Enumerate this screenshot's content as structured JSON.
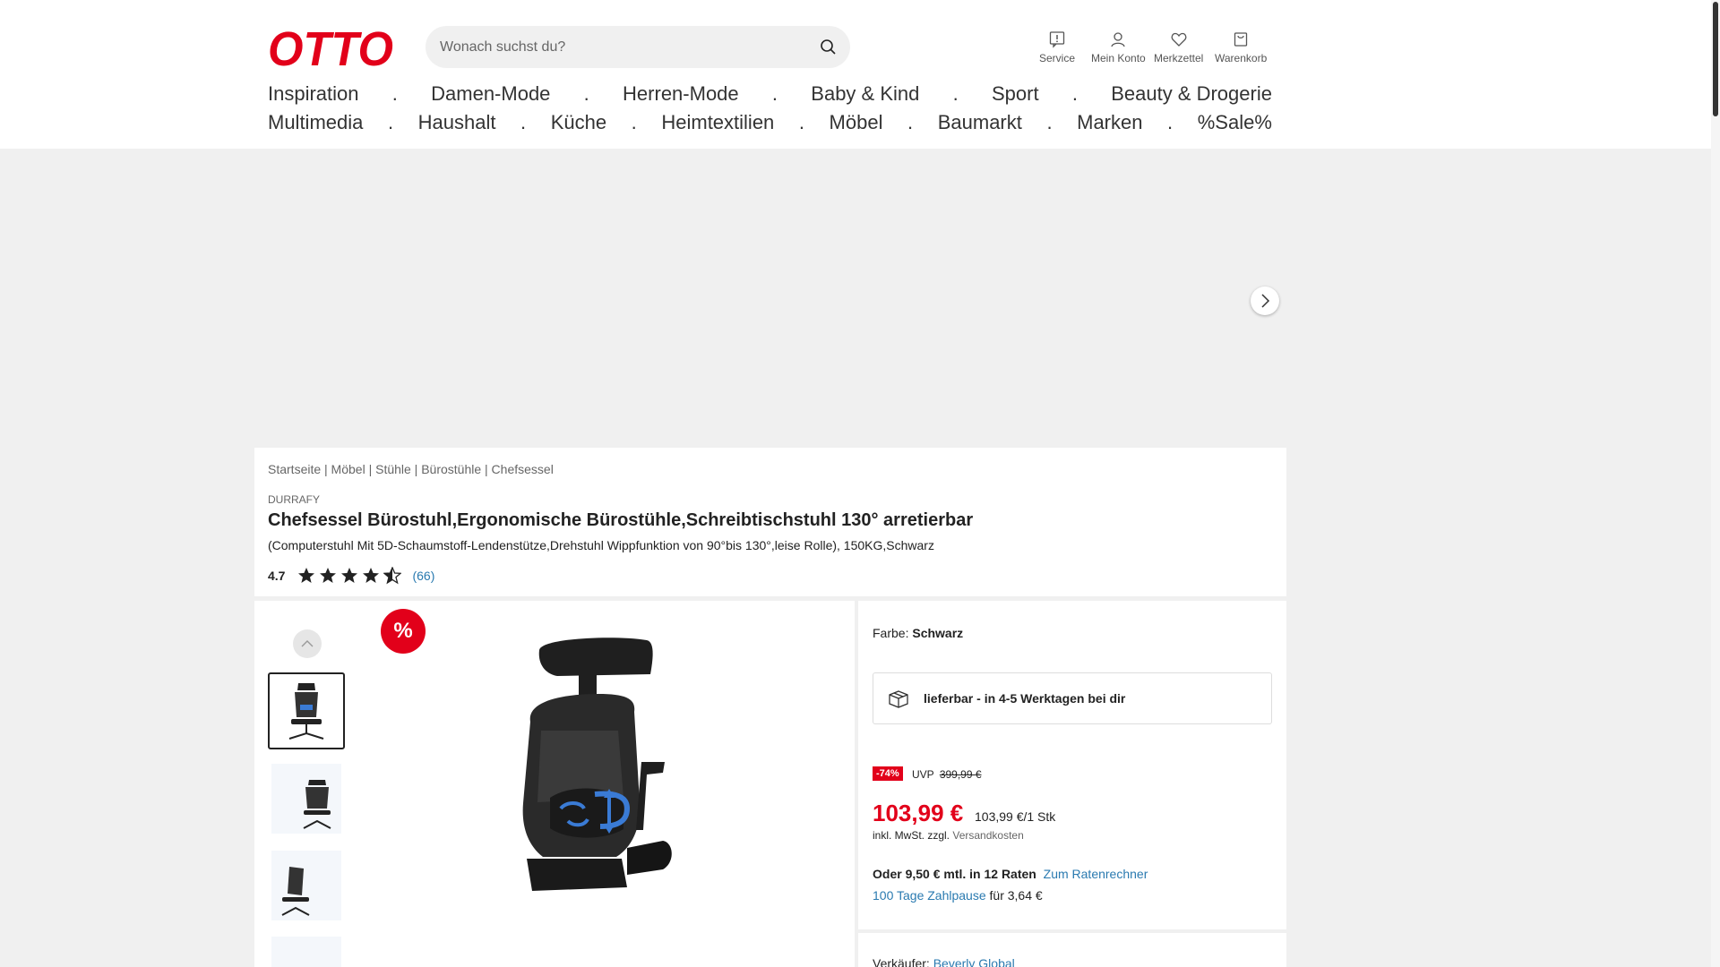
{
  "header": {
    "logo_text": "OTTO",
    "search_placeholder": "Wonach suchst du?",
    "icons": [
      {
        "label": "Service",
        "icon": "info-icon"
      },
      {
        "label": "Mein Konto",
        "icon": "user-icon"
      },
      {
        "label": "Merkzettel",
        "icon": "heart-icon"
      },
      {
        "label": "Warenkorb",
        "icon": "bag-icon"
      }
    ]
  },
  "nav": {
    "row1": [
      "Inspiration",
      "Damen-Mode",
      "Herren-Mode",
      "Baby & Kind",
      "Sport",
      "Beauty & Drogerie"
    ],
    "row2": [
      "Multimedia",
      "Haushalt",
      "Küche",
      "Heimtextilien",
      "Möbel",
      "Baumarkt",
      "Marken",
      "%Sale%"
    ],
    "separator": "."
  },
  "product": {
    "breadcrumb": "Startseite | Möbel | Stühle | Bürostühle | Chefsessel",
    "brand": "DURRAFY",
    "title": "Chefsessel Bürostuhl,Ergonomische Bürostühle,Schreibtischstuhl 130° arretierbar",
    "subtitle": "(Computerstuhl Mit 5D-Schaumstoff-Lendenstütze,Drehstuhl Wippfunktion von 90°bis 130°,leise Rolle), 150KG,Schwarz",
    "rating_value": "4.7",
    "rating_stars": 4.5,
    "rating_count": "(66)"
  },
  "gallery": {
    "sale_badge": "%",
    "thumbnails": 4
  },
  "buybox": {
    "farbe_label": "Farbe:",
    "farbe_value": "Schwarz",
    "delivery": "lieferbar - in 4-5 Werktagen bei dir",
    "discount": "-74%",
    "uvp_label": "UVP",
    "uvp_value": "399,99 €",
    "price": "103,99 €",
    "unit_price": "103,99 €/1 Stk",
    "tax_text": "inkl. MwSt. zzgl.",
    "tax_link": "Versandkosten",
    "raten_text": "Oder 9,50 € mtl. in 12 Raten",
    "raten_link": "Zum Ratenrechner",
    "zahlpause_link": "100 Tage Zahlpause",
    "zahlpause_text": "für 3,64 €",
    "seller_label": "Verkäufer:",
    "seller_name": "Beverly Global"
  },
  "colors": {
    "brand_red": "#e2001a",
    "link_blue": "#2a7ab0"
  }
}
